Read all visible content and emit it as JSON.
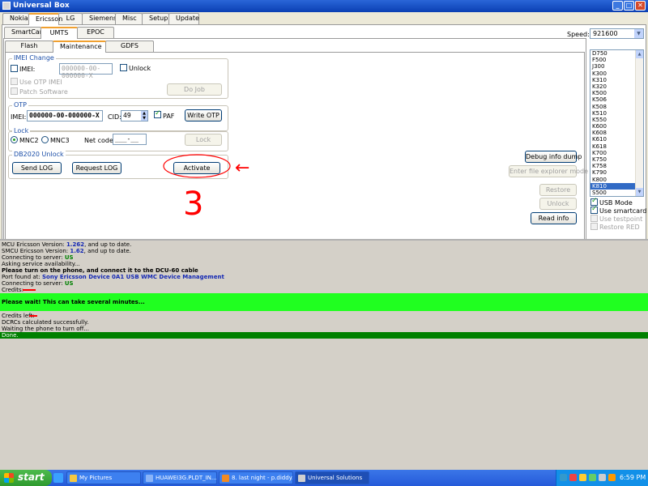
{
  "window": {
    "title": "Universal Box"
  },
  "colors": {
    "log_highlight": "#20ff20",
    "log_done": "#008000",
    "annotation": "#ff0000",
    "selected": "#316ac5"
  },
  "tabs_main": [
    "Nokia",
    "Ericsson",
    "LG",
    "Siemens",
    "Misc",
    "Setup",
    "Update"
  ],
  "tabs_sub": [
    "SmartCard",
    "UMTS",
    "EPOC"
  ],
  "tabs_inner": [
    "Flash",
    "Maintenance",
    "GDFS"
  ],
  "imei_change": {
    "legend": "IMEI Change",
    "imei_label": "IMEI:",
    "imei_value": "000000-00-000000-X",
    "unlock_label": "Unlock",
    "use_otp_label": "Use OTP IMEI",
    "patch_label": "Patch Software",
    "do_job": "Do Job"
  },
  "otp": {
    "legend": "OTP",
    "imei_label": "IMEI:",
    "imei_value": "000000-00-000000-X",
    "cid_label": "CID:",
    "cid_value": "49",
    "paf_label": "PAF",
    "write_otp": "Write OTP"
  },
  "lock": {
    "legend": "Lock",
    "mnc2": "MNC2",
    "mnc3": "MNC3",
    "net_code_label": "Net code:",
    "net_code_value": "___-__",
    "lock_button": "Lock"
  },
  "db2020": {
    "legend": "DB2020 Unlock",
    "send_log": "Send LOG",
    "request_log": "Request LOG",
    "activate": "Activate"
  },
  "right_buttons": {
    "debug": "Debug info dump",
    "explorer": "Enter file explorer mode",
    "restore": "Restore",
    "unlock": "Unlock",
    "read_info": "Read info"
  },
  "speed": {
    "label": "Speed:",
    "value": "921600"
  },
  "models": [
    "D750",
    "F500",
    "J300",
    "K300",
    "K310",
    "K320",
    "K500",
    "K506",
    "K508",
    "K510",
    "K550",
    "K600",
    "K608",
    "K610",
    "K618",
    "K700",
    "K750",
    "K758",
    "K790",
    "K800",
    "K810",
    "S500"
  ],
  "selected_model": "K810",
  "options": {
    "usb_mode": "USB Mode",
    "use_smartcard": "Use smartcard",
    "use_testpoint": "Use testpoint",
    "restore_red": "Restore RED"
  },
  "annotation": {
    "step": "3",
    "arrow": "←"
  },
  "log": {
    "l1_pre": "MCU Ericsson Version: ",
    "l1_ver": "1.262",
    "l1_post": ", and up to date.",
    "l2_pre": "SMCU Ericsson Version: ",
    "l2_ver": "1.62",
    "l2_post": ", and up to date.",
    "l3_pre": "Connecting to server: ",
    "l3_val": "US",
    "l4": "Asking service availability...",
    "l5": "Please turn on the phone, and connect it to the DCU-60 cable",
    "l6_pre": "Port found at: ",
    "l6_val": "Sony Ericsson Device 0A1 USB WMC Device Management",
    "l7_pre": "Connecting to server: ",
    "l7_val": "US",
    "l8": "Credits:",
    "banner": "Please wait! This can take several minutes...",
    "l9": "Credits left:",
    "l10": "DCRCs calculated successfully.",
    "l11": "Waiting the phone to turn off...",
    "done": "Done."
  },
  "taskbar": {
    "start": "start",
    "tasks": [
      "My Pictures",
      "HUAWEI3G.PLDT_IN...",
      "8. last night - p.diddy...",
      "Universal Solutions"
    ],
    "clock": "6:59 PM"
  }
}
